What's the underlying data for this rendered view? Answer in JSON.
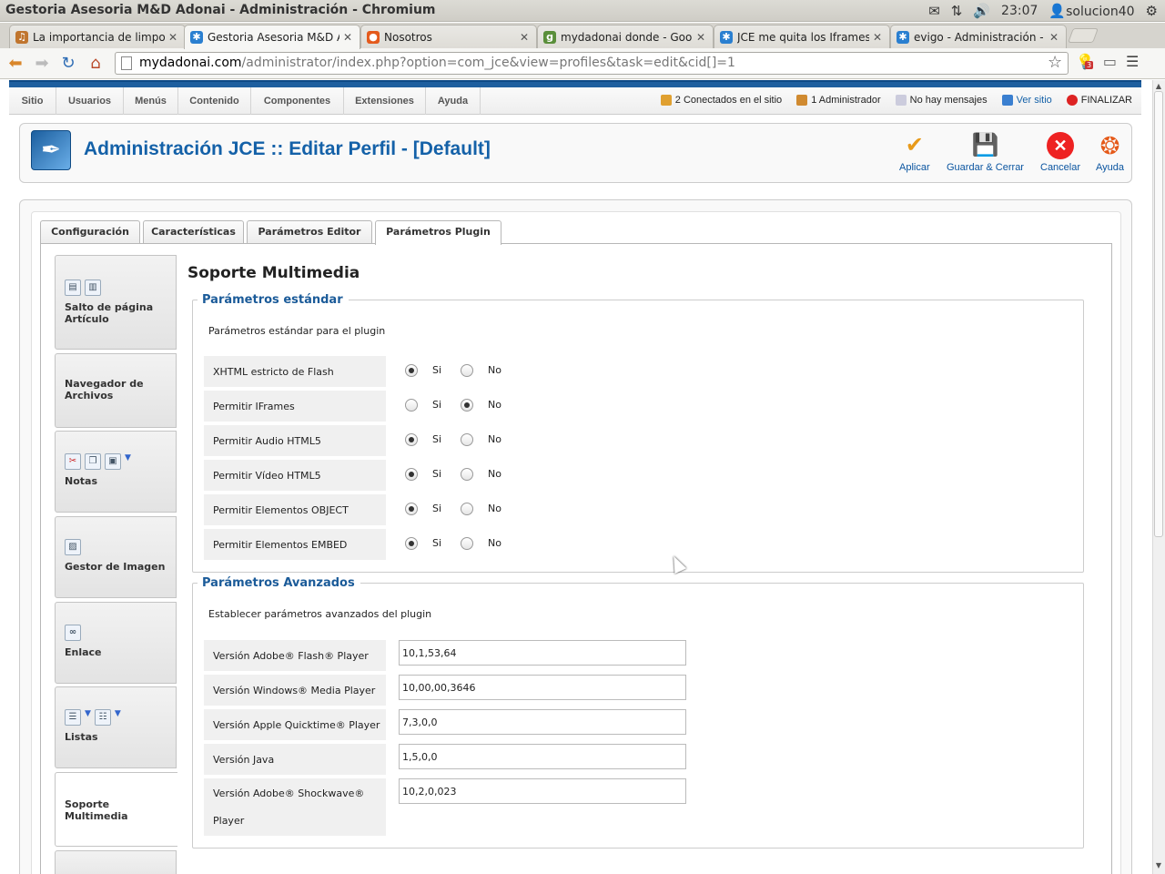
{
  "window": {
    "title": "Gestoria Asesoria M&D Adonai - Administración - Chromium"
  },
  "tray": {
    "time": "23:07",
    "user": "solucion40"
  },
  "tabs": [
    {
      "label": "La importancia de limport",
      "active": false,
      "color": "#c0752e",
      "glyph": "♫"
    },
    {
      "label": "Gestoria Asesoria M&D Ac",
      "active": true,
      "color": "#2a7fd0",
      "glyph": "✱"
    },
    {
      "label": "Nosotros",
      "active": false,
      "color": "#e45a1c",
      "glyph": "●"
    },
    {
      "label": "mydadonai donde - Googl",
      "active": false,
      "color": "#5a8f3a",
      "glyph": "g"
    },
    {
      "label": "JCE me quita los Iframes.",
      "active": false,
      "color": "#2a7fd0",
      "glyph": "✱"
    },
    {
      "label": "evigo - Administración - A",
      "active": false,
      "color": "#2a7fd0",
      "glyph": "✱"
    }
  ],
  "address": {
    "host": "mydadonai.com",
    "path": "/administrator/index.php?option=com_jce&view=profiles&task=edit&cid[]=1"
  },
  "ext": {
    "badge": "3"
  },
  "menubar": [
    "Sitio",
    "Usuarios",
    "Menús",
    "Contenido",
    "Componentes",
    "Extensiones",
    "Ayuda"
  ],
  "status": {
    "connected": "2 Conectados en el sitio",
    "admins": "1 Administrador",
    "messages": "No hay mensajes",
    "view_site": "Ver sitio",
    "logout": "FINALIZAR"
  },
  "header": {
    "title": "Administración JCE :: Editar Perfil - [Default]"
  },
  "toolbar_buttons": {
    "apply": "Aplicar",
    "save_close": "Guardar & Cerrar",
    "cancel": "Cancelar",
    "help": "Ayuda"
  },
  "panel_tabs": [
    "Configuración",
    "Características",
    "Parámetros Editor",
    "Parámetros Plugin"
  ],
  "plugins": [
    {
      "label": "Salto de página Artículo"
    },
    {
      "label": "Navegador de Archivos"
    },
    {
      "label": "Notas"
    },
    {
      "label": "Gestor de Imagen"
    },
    {
      "label": "Enlace"
    },
    {
      "label": "Listas"
    },
    {
      "label": "Soporte Multimedia"
    }
  ],
  "section": {
    "title": "Soporte Multimedia"
  },
  "standard": {
    "legend": "Parámetros estándar",
    "description": "Parámetros estándar para el plugin",
    "yes": "Si",
    "no": "No",
    "rows": [
      {
        "label": "XHTML estricto de Flash",
        "value": "Si"
      },
      {
        "label": "Permitir IFrames",
        "value": "No"
      },
      {
        "label": "Permitir Audio HTML5",
        "value": "Si"
      },
      {
        "label": "Permitir Vídeo HTML5",
        "value": "Si"
      },
      {
        "label": "Permitir Elementos OBJECT",
        "value": "Si"
      },
      {
        "label": "Permitir Elementos EMBED",
        "value": "Si"
      }
    ]
  },
  "advanced": {
    "legend": "Parámetros Avanzados",
    "description": "Establecer parámetros avanzados del plugin",
    "rows": [
      {
        "label": "Versión Adobe® Flash® Player",
        "value": "10,1,53,64"
      },
      {
        "label": "Versión Windows® Media Player",
        "value": "10,00,00,3646"
      },
      {
        "label": "Versión Apple Quicktime® Player",
        "value": "7,3,0,0"
      },
      {
        "label": "Versión Java",
        "value": "1,5,0,0"
      },
      {
        "label": "Versión Adobe® Shockwave® Player",
        "value": "10,2,0,023"
      }
    ]
  }
}
